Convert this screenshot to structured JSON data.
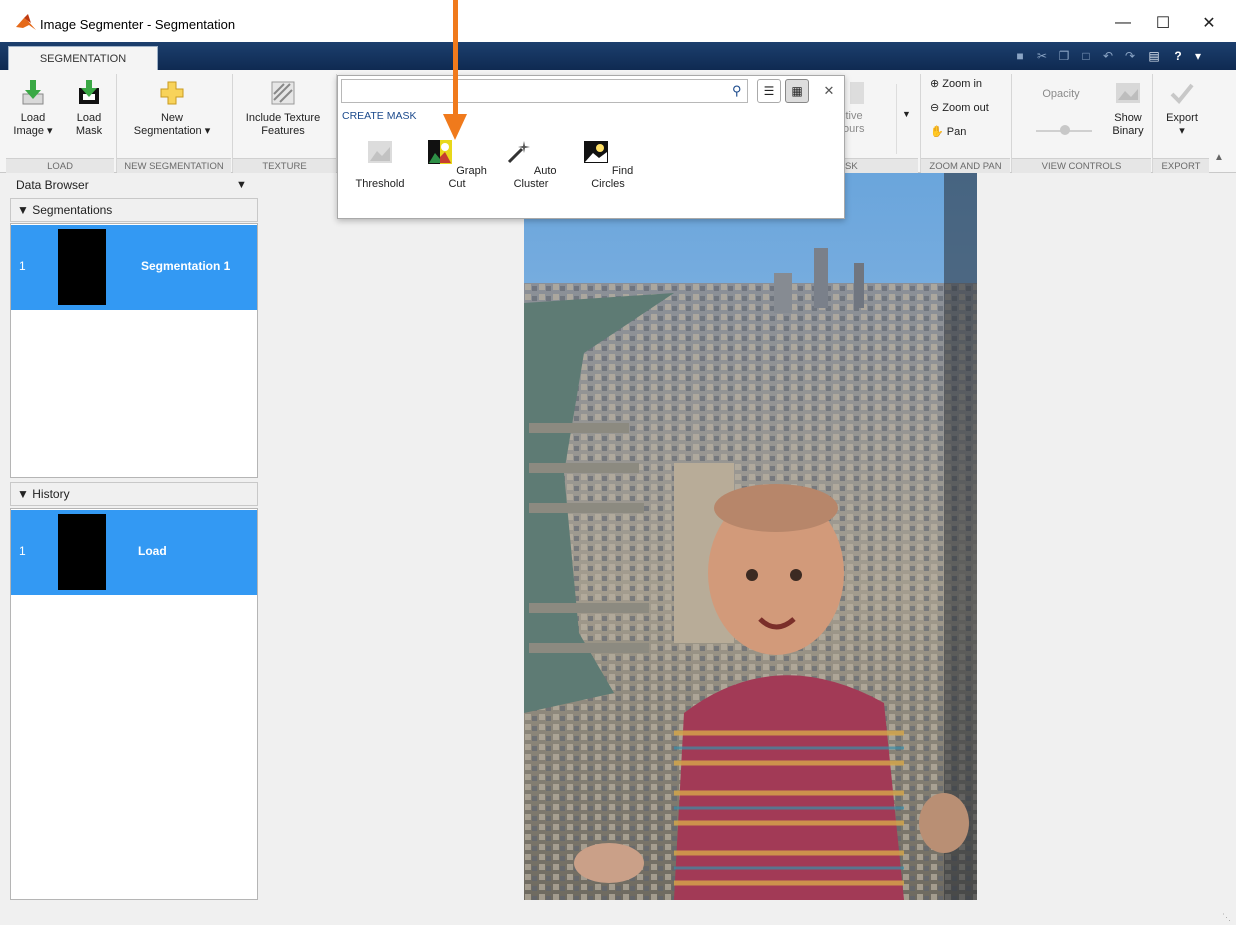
{
  "window": {
    "title": "Image Segmenter - Segmentation"
  },
  "tab": {
    "label": "SEGMENTATION"
  },
  "ribbon": {
    "load": {
      "load_image": [
        "Load",
        "Image ▾"
      ],
      "load_mask": [
        "Load",
        "Mask"
      ],
      "group": "LOAD"
    },
    "new_segmentation": {
      "label": [
        "New",
        "Segmentation ▾"
      ],
      "group": "NEW SEGMENTATION"
    },
    "texture": {
      "label": [
        "Include Texture",
        "Features"
      ],
      "group": "TEXTURE"
    },
    "refine": {
      "label": [
        "ctive",
        "tours"
      ],
      "group": "SK"
    },
    "zoom_pan": {
      "zoom_in": "Zoom in",
      "zoom_out": "Zoom out",
      "pan": "Pan",
      "group": "ZOOM AND PAN"
    },
    "view_controls": {
      "opacity": "Opacity",
      "show_binary": [
        "Show",
        "Binary"
      ],
      "group": "VIEW CONTROLS"
    },
    "export": {
      "label": "Export",
      "group": "EXPORT"
    }
  },
  "gallery": {
    "search_value": "",
    "section": "CREATE MASK",
    "items": [
      {
        "label": [
          "Threshold",
          ""
        ]
      },
      {
        "label": [
          "Graph",
          "Cut"
        ]
      },
      {
        "label": [
          "Auto",
          "Cluster"
        ]
      },
      {
        "label": [
          "Find",
          "Circles"
        ]
      }
    ]
  },
  "data_browser": {
    "title": "Data Browser",
    "segmentations": {
      "header": "Segmentations",
      "rows": [
        {
          "index": "1",
          "name": "Segmentation 1"
        }
      ]
    },
    "history": {
      "header": "History",
      "rows": [
        {
          "index": "1",
          "name": "Load"
        }
      ]
    }
  },
  "colors": {
    "accent": "#3399f3",
    "arrow": "#f07a1c",
    "tabstrip": "#1c3f6e"
  }
}
